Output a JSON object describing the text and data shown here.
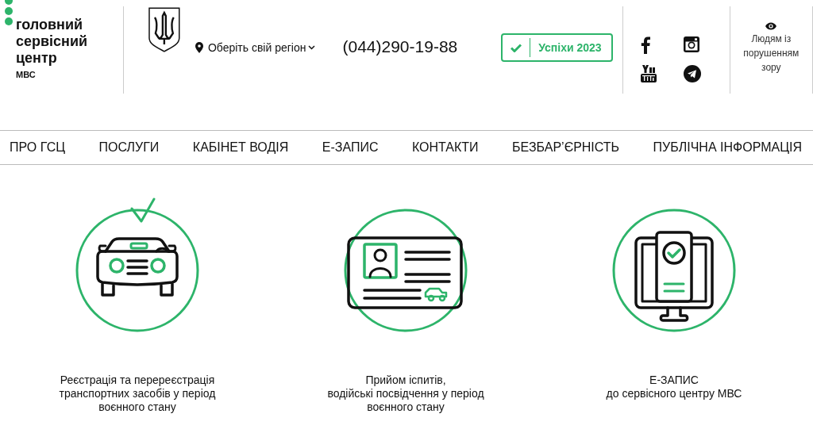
{
  "logo": {
    "lines": [
      "головний",
      "сервісний",
      "центр"
    ],
    "subtitle": "МВС"
  },
  "region": {
    "label": "Оберіть свій регіон"
  },
  "phone": "(044)290-19-88",
  "achievements_button": "Успіхи 2023",
  "social": [
    {
      "kind": "facebook"
    },
    {
      "kind": "instagram"
    },
    {
      "kind": "youtube"
    },
    {
      "kind": "telegram"
    }
  ],
  "accessibility": {
    "label": "Людям із порушенням зору"
  },
  "nav": [
    "ПРО ГСЦ",
    "ПОСЛУГИ",
    "КАБІНЕТ ВОДІЯ",
    "Е-ЗАПИС",
    "КОНТАКТИ",
    "БЕЗБАР’ЄРНІСТЬ",
    "ПУБЛІЧНА ІНФОРМАЦІЯ"
  ],
  "services": [
    {
      "kind": "car",
      "lines": [
        "Реєстрація та перереєстрація",
        "транспортних засобів у період",
        "воєнного стану"
      ]
    },
    {
      "kind": "license",
      "lines": [
        "Прийом іспитів,",
        "водійські посвідчення у період",
        "воєнного стану"
      ]
    },
    {
      "kind": "monitor",
      "lines": [
        "Е-ЗАПИС",
        "до сервісного центру МВС"
      ]
    }
  ]
}
